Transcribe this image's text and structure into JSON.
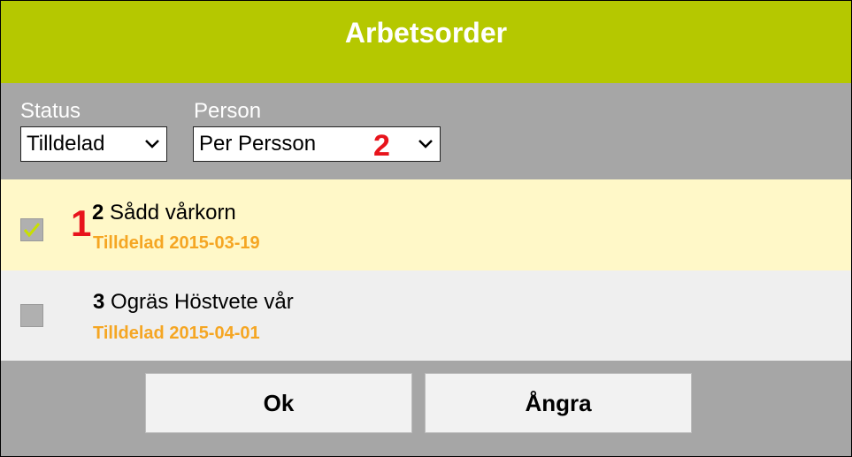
{
  "dialog": {
    "title": "Arbetsorder"
  },
  "filters": {
    "status": {
      "label": "Status",
      "value": "Tilldelad"
    },
    "person": {
      "label": "Person",
      "value": "Per Persson"
    }
  },
  "annotations": {
    "one": "1",
    "two": "2"
  },
  "items": [
    {
      "number": "2",
      "name": "Sådd vårkorn",
      "status": "Tilldelad 2015-03-19",
      "checked": true
    },
    {
      "number": "3",
      "name": "Ogräs Höstvete vår",
      "status": "Tilldelad 2015-04-01",
      "checked": false
    }
  ],
  "buttons": {
    "ok": "Ok",
    "undo": "Ångra"
  },
  "colors": {
    "header": "#b5c800",
    "selected_row": "#fff8c8",
    "status_text": "#f5a623",
    "annotation": "#e8141c",
    "checkmark": "#c8e000"
  }
}
